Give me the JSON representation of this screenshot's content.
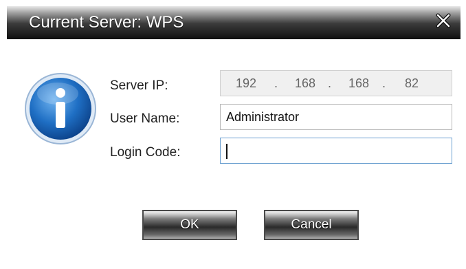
{
  "dialog": {
    "title": "Current Server: WPS",
    "close_icon": "close-icon",
    "info_icon": "info-icon"
  },
  "fields": {
    "server_ip_label": "Server IP:",
    "server_ip_octets": [
      "192",
      "168",
      "168",
      "82"
    ],
    "server_ip_separator": ".",
    "user_name_label": "User Name:",
    "user_name_value": "Administrator",
    "login_code_label": "Login Code:",
    "login_code_value": ""
  },
  "buttons": {
    "ok_label": "OK",
    "cancel_label": "Cancel"
  },
  "colors": {
    "titlebar": "#1a1a1a",
    "info_icon_blue": "#1f6fc4",
    "focus_border": "#6a9fd0"
  }
}
